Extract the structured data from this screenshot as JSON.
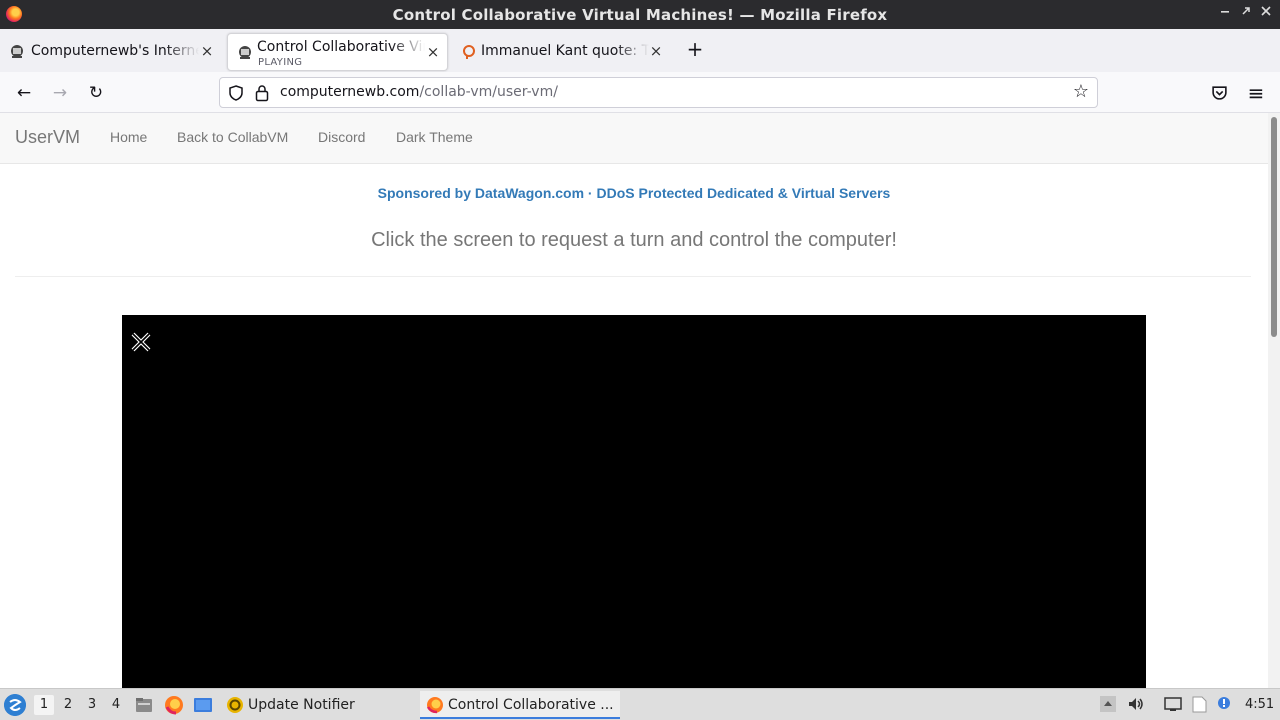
{
  "window": {
    "title": "Control Collaborative Virtual Machines! — Mozilla Firefox",
    "controls": [
      "minimize-icon",
      "maximize-icon",
      "close-icon"
    ]
  },
  "tabs": [
    {
      "label": "Computernewb's Internet",
      "close": "×",
      "active": false
    },
    {
      "label": "Control Collaborative Virt",
      "sub": "PLAYING",
      "close": "×",
      "active": true
    },
    {
      "label": "Immanuel Kant quote: Th",
      "close": "×",
      "active": false
    }
  ],
  "newtab": "+",
  "navbar": {
    "back": "←",
    "forward": "→",
    "reload": "↻",
    "url_host": "computernewb.com",
    "url_path": "/collab-vm/user-vm/",
    "star": "☆",
    "menu": "≡"
  },
  "site": {
    "brand": "UserVM",
    "links": [
      "Home",
      "Back to CollabVM",
      "Discord",
      "Dark Theme"
    ],
    "sponsor": "Sponsored by DataWagon.com · DDoS Protected Dedicated & Virtual Servers",
    "instruction": "Click the screen to request a turn and control the computer!"
  },
  "taskbar": {
    "workspaces": [
      "1",
      "2",
      "3",
      "4"
    ],
    "active_workspace": "1",
    "items": [
      {
        "label": "Update Notifier",
        "icon": "update-notifier-icon"
      },
      {
        "label": "Control Collaborative ...",
        "icon": "firefox-icon",
        "active": true
      }
    ],
    "clock": "4:51"
  },
  "colors": {
    "link": "#337ab7",
    "titlebar": "#2b2b2e",
    "vm_background": "#000000"
  }
}
